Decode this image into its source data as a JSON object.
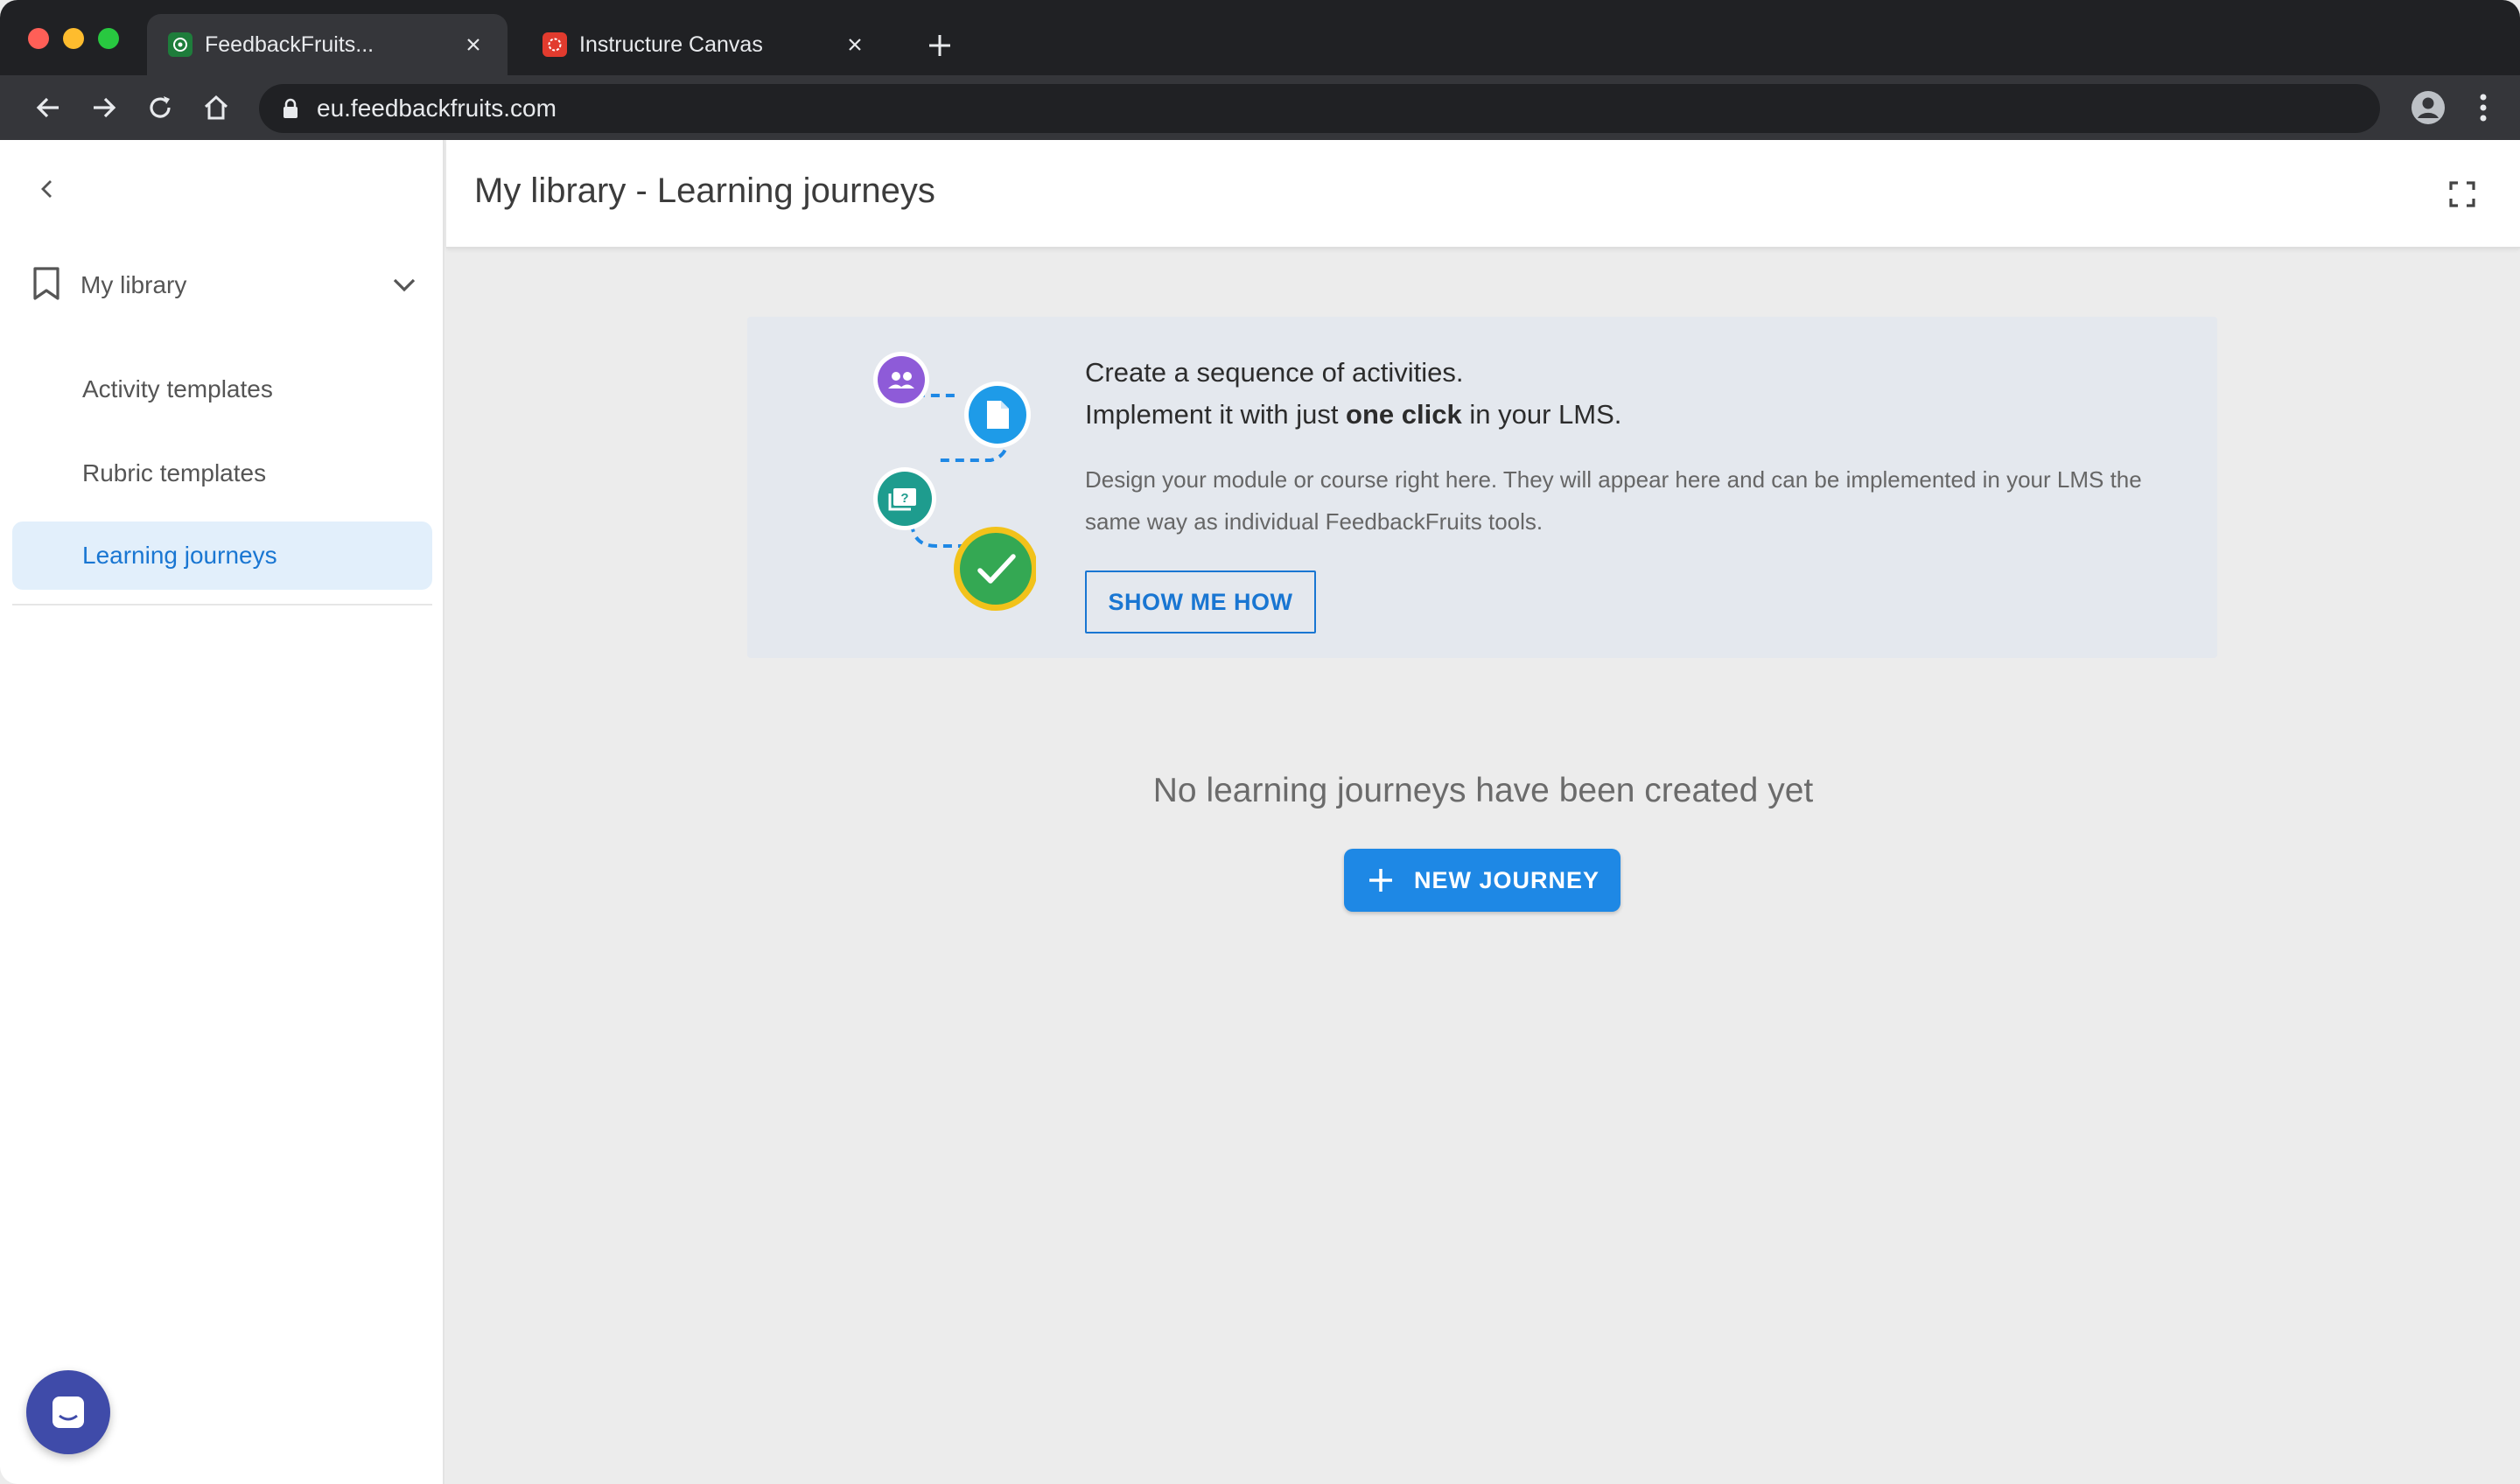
{
  "browser": {
    "tabs": [
      {
        "title": "FeedbackFruits...",
        "favicon": "feedbackfruits-icon",
        "active": true
      },
      {
        "title": "Instructure Canvas",
        "favicon": "canvas-icon",
        "active": false
      }
    ],
    "url": "eu.feedbackfruits.com"
  },
  "sidebar": {
    "section_label": "My library",
    "items": [
      {
        "label": "Activity templates"
      },
      {
        "label": "Rubric templates"
      },
      {
        "label": "Learning journeys",
        "selected": true
      }
    ]
  },
  "main": {
    "title": "My library - Learning journeys",
    "promo": {
      "line1": "Create a sequence of activities.",
      "line2_prefix": "Implement it with just ",
      "line2_bold": "one click",
      "line2_suffix": " in your LMS.",
      "description": "Design your module or course right here. They will appear here and can be implemented in your LMS the same way as individual FeedbackFruits tools.",
      "button_label": "SHOW ME HOW"
    },
    "empty_state": "No learning journeys have been created yet",
    "new_button_label": "NEW JOURNEY"
  },
  "colors": {
    "accent": "#1976d2",
    "primary_button": "#1e88e5",
    "selected_bg": "#e2effb",
    "chat_fab": "#3f4ba9"
  }
}
